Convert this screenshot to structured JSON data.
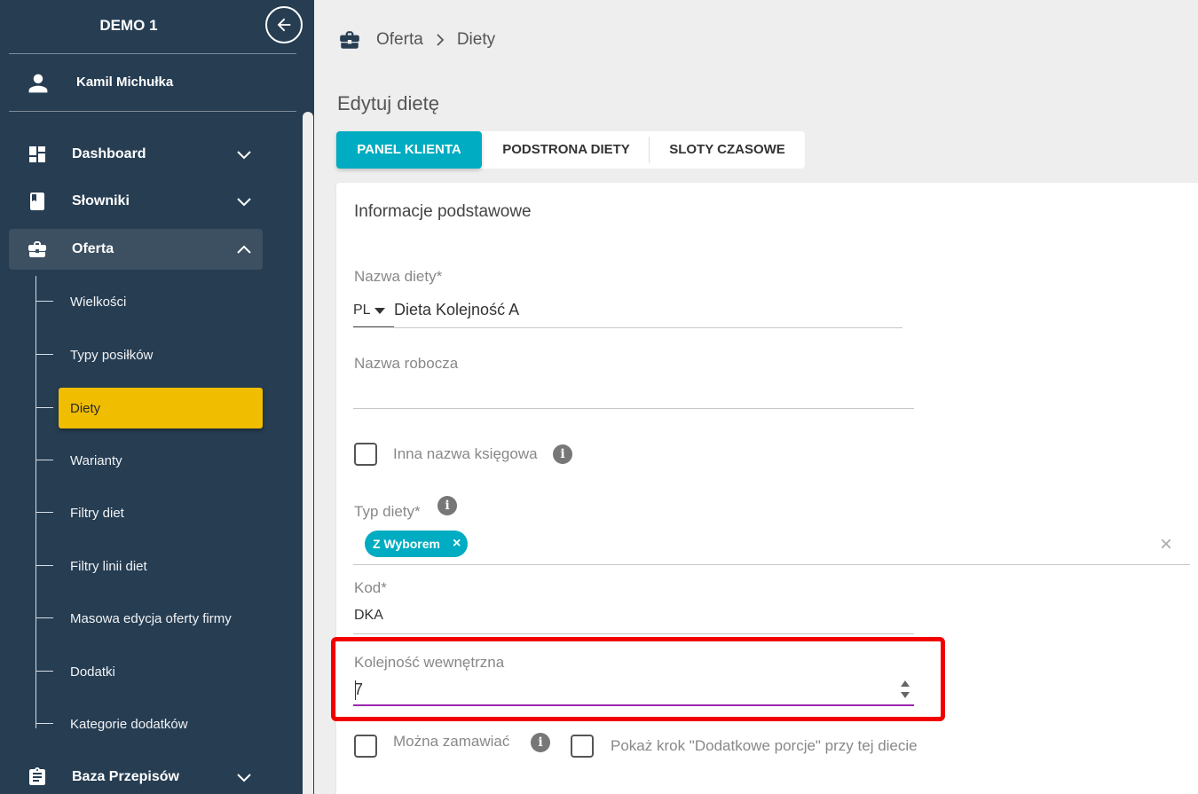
{
  "sidebar": {
    "brand": "DEMO 1",
    "user": "Kamil Michułka",
    "nav": [
      {
        "label": "Dashboard",
        "icon": "dashboard-icon"
      },
      {
        "label": "Słowniki",
        "icon": "book-icon"
      },
      {
        "label": "Oferta",
        "icon": "briefcase-icon"
      },
      {
        "label": "Baza Przepisów",
        "icon": "clipboard-icon"
      }
    ],
    "sub_items": [
      {
        "label": "Wielkości"
      },
      {
        "label": "Typy posiłków"
      },
      {
        "label": "Diety"
      },
      {
        "label": "Warianty"
      },
      {
        "label": "Filtry diet"
      },
      {
        "label": "Filtry linii diet"
      },
      {
        "label": "Masowa edycja oferty firmy"
      },
      {
        "label": "Dodatki"
      },
      {
        "label": "Kategorie dodatków"
      }
    ],
    "active_sub": "Diety"
  },
  "breadcrumb": {
    "root": "Oferta",
    "current": "Diety"
  },
  "page_title": "Edytuj dietę",
  "tabs": [
    {
      "label": "PANEL KLIENTA",
      "active": true
    },
    {
      "label": "PODSTRONA DIETY",
      "active": false
    },
    {
      "label": "SLOTY CZASOWE",
      "active": false
    }
  ],
  "form": {
    "section_title": "Informacje podstawowe",
    "diet_name": {
      "label": "Nazwa diety*",
      "lang": "PL",
      "value": "Dieta Kolejność A"
    },
    "working_name": {
      "label": "Nazwa robocza",
      "value": ""
    },
    "accounting_name": {
      "label": "Inna nazwa księgowa",
      "checked": false
    },
    "diet_type": {
      "label": "Typ diety*",
      "chip": "Z Wyborem",
      "clear": "×"
    },
    "code": {
      "label": "Kod*",
      "value": "DKA"
    },
    "internal_order": {
      "label": "Kolejność wewnętrzna",
      "value": "7"
    },
    "orderable": {
      "label": "Można zamawiać",
      "checked": false
    },
    "extra_portions": {
      "label": "Pokaż krok \"Dodatkowe porcje\" przy tej diecie",
      "checked": false
    }
  },
  "colors": {
    "sidebar_bg": "#263d52",
    "accent": "#00acc1",
    "active_item": "#f0bd00",
    "highlight": "#f20000",
    "focus_underline": "#9c27b0"
  }
}
